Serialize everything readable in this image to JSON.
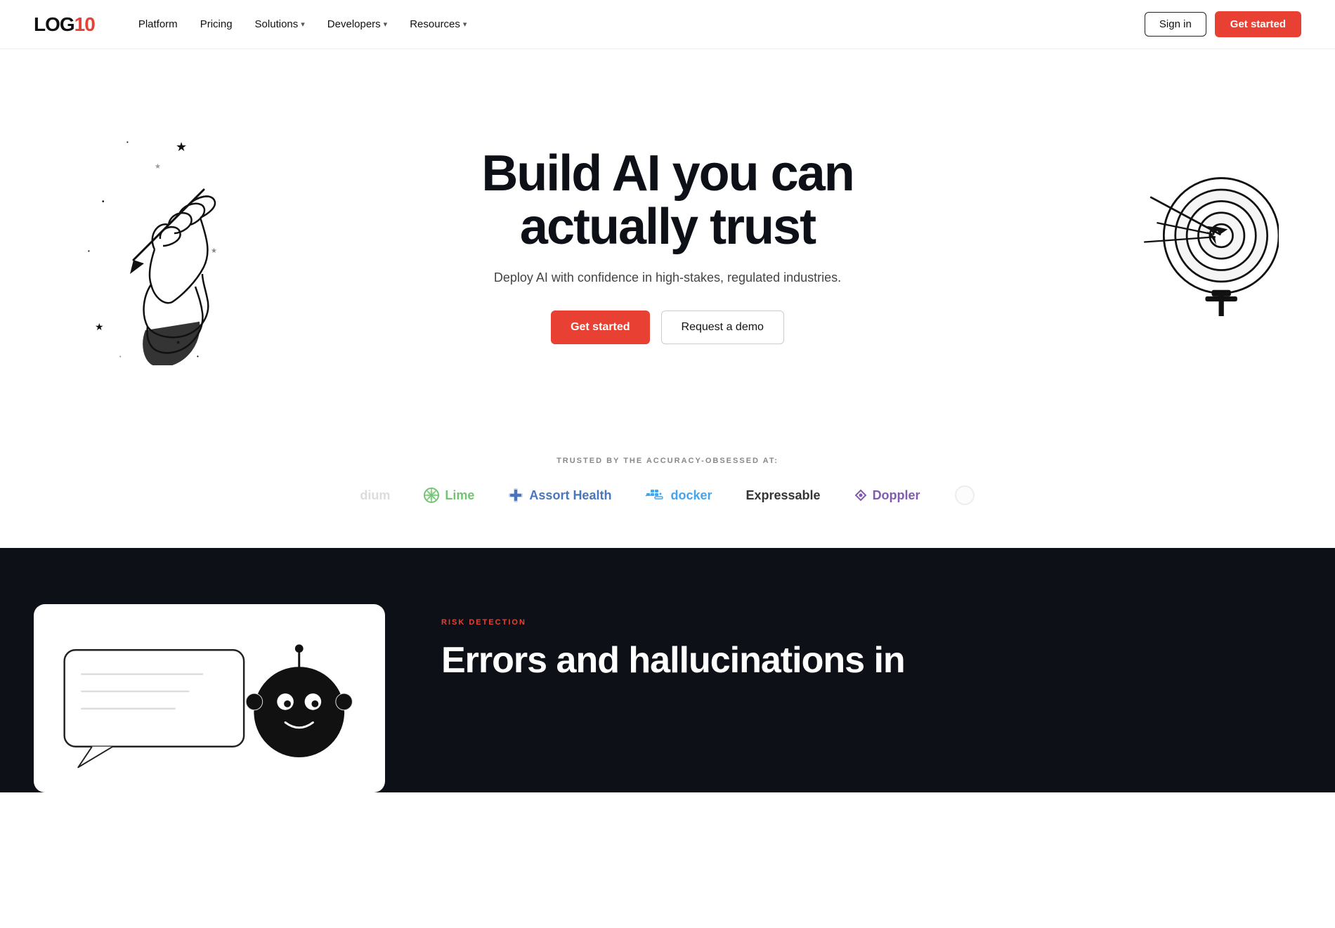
{
  "navbar": {
    "logo_log": "LOG",
    "logo_10": "10",
    "links": [
      {
        "label": "Platform",
        "has_dropdown": false
      },
      {
        "label": "Pricing",
        "has_dropdown": false
      },
      {
        "label": "Solutions",
        "has_dropdown": true
      },
      {
        "label": "Developers",
        "has_dropdown": true
      },
      {
        "label": "Resources",
        "has_dropdown": true
      }
    ],
    "signin_label": "Sign in",
    "getstarted_label": "Get started"
  },
  "hero": {
    "title": "Build AI you can actually trust",
    "subtitle": "Deploy AI with confidence in high-stakes, regulated industries.",
    "getstarted_label": "Get started",
    "demo_label": "Request a demo"
  },
  "trusted": {
    "label": "TRUSTED BY THE ACCURACY-OBSESSED AT:",
    "logos": [
      {
        "name": "dium",
        "display": "dium",
        "type": "partial"
      },
      {
        "name": "Lime",
        "display": "Lime",
        "type": "lime"
      },
      {
        "name": "Assort Health",
        "display": "Assort Health",
        "type": "assort"
      },
      {
        "name": "Docker",
        "display": "docker",
        "type": "docker"
      },
      {
        "name": "Expressable",
        "display": "Expressable",
        "type": "expressable"
      },
      {
        "name": "Doppler",
        "display": "Doppler",
        "type": "doppler"
      },
      {
        "name": "partial-right",
        "display": "",
        "type": "partial-circle"
      }
    ]
  },
  "dark_section": {
    "section_label": "RISK DETECTION",
    "section_title": "Errors and hallucinations in",
    "card_alt": "Risk detection illustration"
  }
}
